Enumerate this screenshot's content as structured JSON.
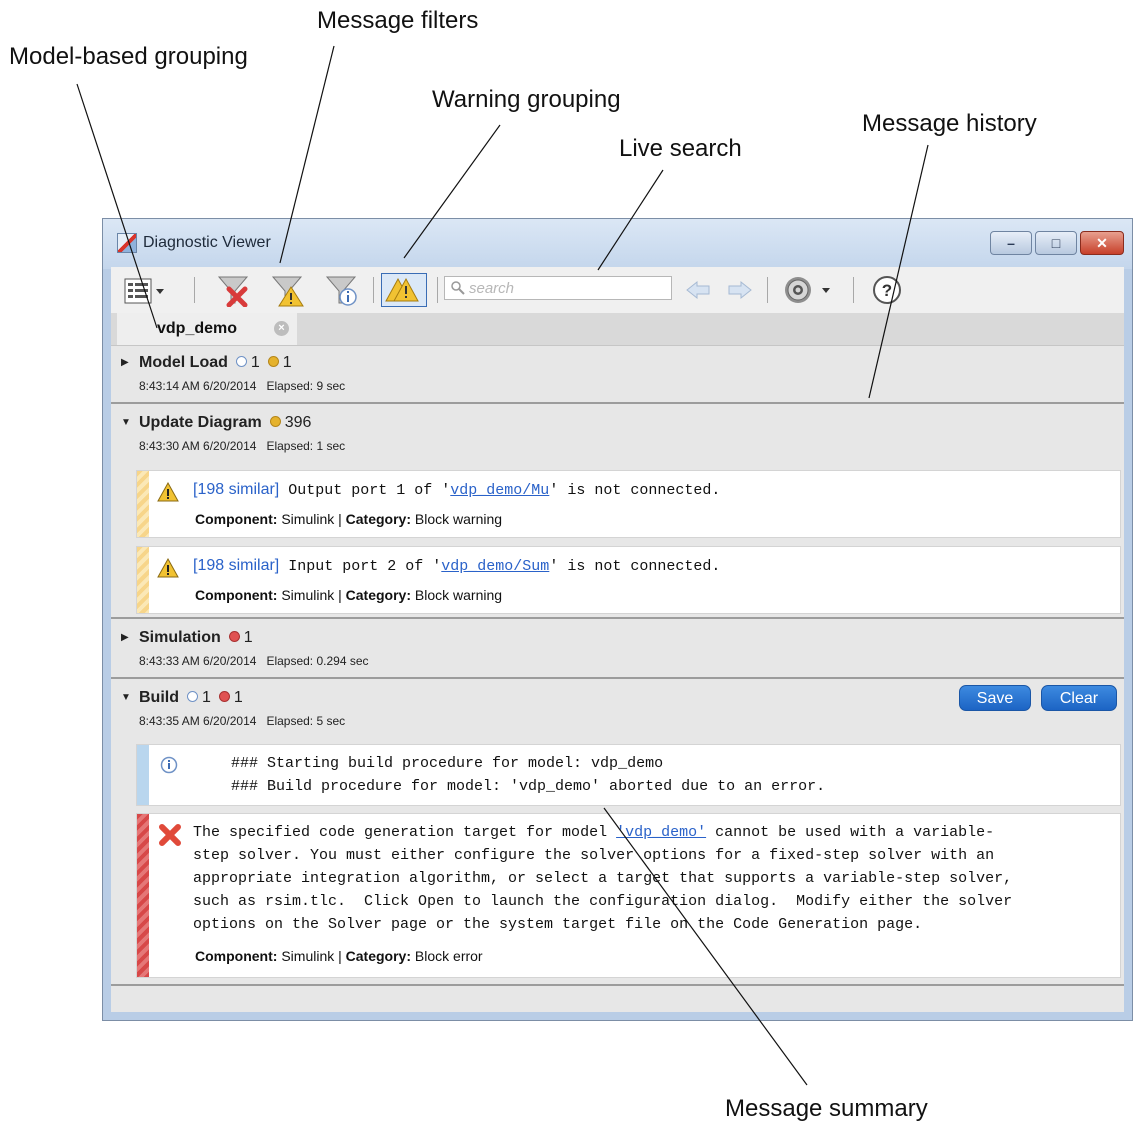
{
  "callouts": {
    "model_grouping": "Model-based grouping",
    "message_filters": "Message filters",
    "warning_grouping": "Warning grouping",
    "live_search": "Live search",
    "message_history": "Message history",
    "message_summary": "Message summary"
  },
  "window": {
    "title": "Diagnostic Viewer"
  },
  "toolbar": {
    "search_placeholder": "search"
  },
  "tab": {
    "label": "vdp_demo"
  },
  "groups": {
    "model_load": {
      "title": "Model Load",
      "info_count": "1",
      "warn_count": "1",
      "time": "8:43:14 AM 6/20/2014",
      "elapsed": "Elapsed: 9 sec"
    },
    "update_diagram": {
      "title": "Update Diagram",
      "warn_count": "396",
      "time": "8:43:30 AM 6/20/2014",
      "elapsed": "Elapsed: 1 sec",
      "messages": [
        {
          "similar": "[198 similar]",
          "pre": " Output port 1 of '",
          "link": "vdp_demo/Mu",
          "post": "' is not connected.",
          "component_label": "Component:",
          "component": "Simulink",
          "category_label": "Category:",
          "category": "Block warning"
        },
        {
          "similar": "[198 similar]",
          "pre": " Input port 2 of '",
          "link": "vdp_demo/Sum",
          "post": "' is not connected.",
          "component_label": "Component:",
          "component": "Simulink",
          "category_label": "Category:",
          "category": "Block warning"
        }
      ]
    },
    "simulation": {
      "title": "Simulation",
      "err_count": "1",
      "time": "8:43:33 AM 6/20/2014",
      "elapsed": "Elapsed: 0.294 sec"
    },
    "build": {
      "title": "Build",
      "info_count": "1",
      "err_count": "1",
      "time": "8:43:35 AM 6/20/2014",
      "elapsed": "Elapsed: 5 sec",
      "save_label": "Save",
      "clear_label": "Clear",
      "info_line1": "### Starting build procedure for model: vdp_demo",
      "info_line2": "### Build procedure for model: 'vdp_demo' aborted due to an error.",
      "err_pre": "The specified code generation target for model ",
      "err_link": "'vdp_demo'",
      "err_post": " cannot be used with a variable-",
      "err_line2": "step solver. You must either configure the solver options for a fixed-step solver with an",
      "err_line3": "appropriate integration algorithm, or select a target that supports a variable-step solver,",
      "err_line4": "such as rsim.tlc.  Click Open to launch the configuration dialog.  Modify either the solver",
      "err_line5": "options on the Solver page or the system target file on the Code Generation page.",
      "component_label": "Component:",
      "component": "Simulink",
      "category_label": "Category:",
      "category": "Block error"
    }
  }
}
